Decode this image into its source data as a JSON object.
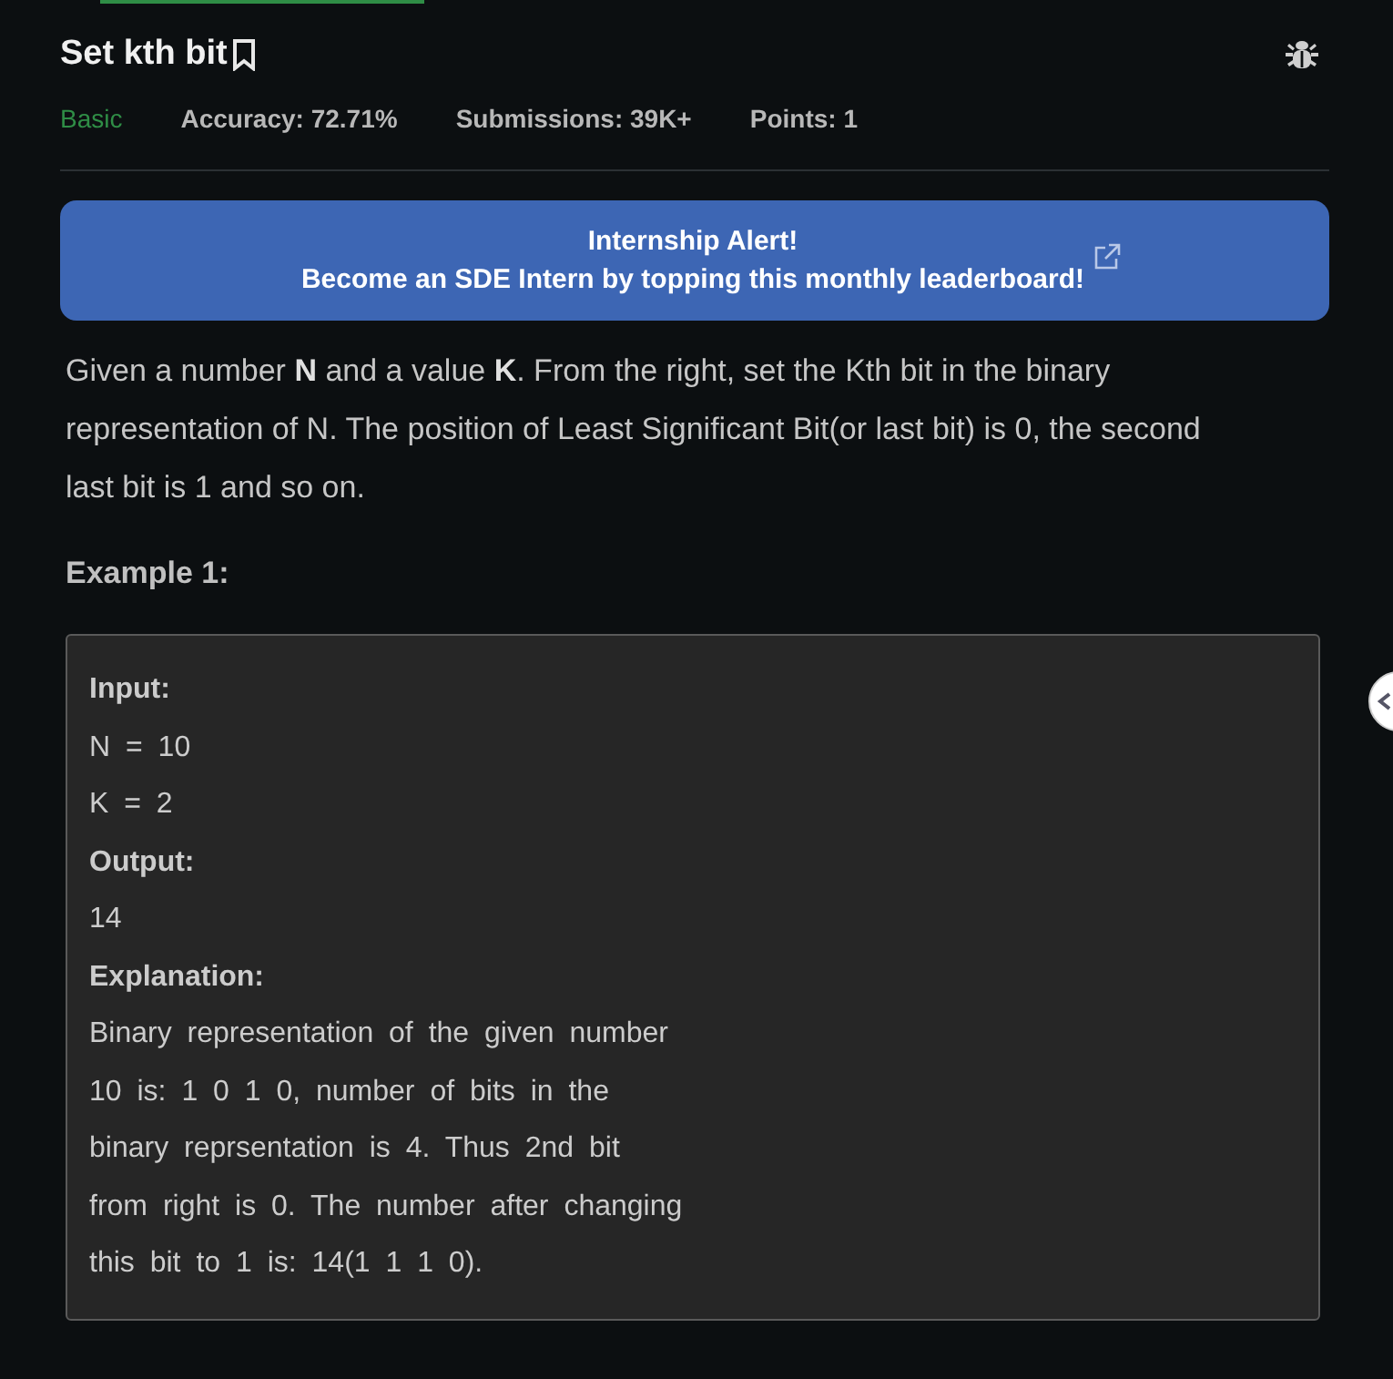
{
  "title": "Set kth bit",
  "meta": {
    "difficulty": "Basic",
    "accuracy": "Accuracy: 72.71%",
    "submissions": "Submissions: 39K+",
    "points": "Points: 1"
  },
  "banner": {
    "title": "Internship Alert!",
    "text": "Become an SDE Intern by topping this monthly leaderboard!"
  },
  "description": "Given a number **N** and a value **K**. From the right, set the Kth bit in the binary representation of N. The position of Least Significant Bit(or last bit) is 0, the second last bit is 1 and so on.",
  "example_heading": "Example 1:",
  "example": [
    {
      "kind": "label",
      "text": "Input:"
    },
    {
      "kind": "text",
      "text": "N = 10"
    },
    {
      "kind": "text",
      "text": "K = 2"
    },
    {
      "kind": "label",
      "text": "Output:"
    },
    {
      "kind": "text",
      "text": "14"
    },
    {
      "kind": "label",
      "text": "Explanation:"
    },
    {
      "kind": "text",
      "text": "Binary representation of the given number"
    },
    {
      "kind": "text",
      "text": "10 is: 1 0 1 0, number of bits in the"
    },
    {
      "kind": "text",
      "text": "binary reprsentation is 4. Thus 2nd bit"
    },
    {
      "kind": "text",
      "text": "from right is 0. The number after changing"
    },
    {
      "kind": "text",
      "text": "this bit to 1 is: 14(1 1 1 0)."
    }
  ]
}
